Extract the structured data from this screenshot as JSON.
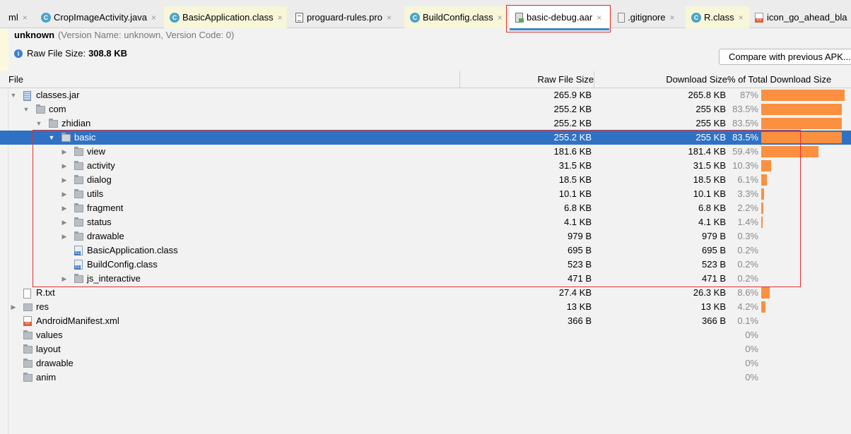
{
  "tabs": [
    {
      "label": "ml",
      "close": "×",
      "icon": "file-icon",
      "style": "plain"
    },
    {
      "label": "CropImageActivity.java",
      "close": "×",
      "icon": "class-icon",
      "icon_glyph": "C",
      "style": "plain"
    },
    {
      "label": "BasicApplication.class",
      "close": "×",
      "icon": "class-icon",
      "icon_glyph": "C",
      "style": "yellow"
    },
    {
      "label": "proguard-rules.pro",
      "close": "×",
      "icon": "file-icon",
      "style": "plain"
    },
    {
      "label": "BuildConfig.class",
      "close": "×",
      "icon": "class-icon",
      "icon_glyph": "C",
      "style": "yellow"
    },
    {
      "label": "basic-debug.aar",
      "close": "×",
      "icon": "aar-icon",
      "style": "active"
    },
    {
      "label": ".gitignore",
      "close": "×",
      "icon": "gitignore-icon",
      "style": "plain"
    },
    {
      "label": "R.class",
      "close": "×",
      "icon": "class-icon",
      "icon_glyph": "C",
      "style": "yellow"
    },
    {
      "label": "icon_go_ahead_bla",
      "close": "",
      "icon": "xml-icon",
      "style": "plain"
    }
  ],
  "summary": {
    "app_name": "unknown",
    "version_info": "(Version Name: unknown, Version Code: 0)",
    "info_glyph": "i",
    "raw_file_size_label": "Raw File Size:",
    "raw_file_size_value": "308.8 KB",
    "compare_button": "Compare with previous APK..."
  },
  "table": {
    "columns": [
      "File",
      "Raw File Size",
      "Download Size",
      "% of Total Download Size"
    ],
    "rows": [
      {
        "name": "classes.jar",
        "depth": 0,
        "arrow": "▼",
        "icon": "jar-icon",
        "raw": "265.9 KB",
        "download": "265.8 KB",
        "percent": "87%",
        "fraction": 0.87,
        "selected": false
      },
      {
        "name": "com",
        "depth": 1,
        "arrow": "▼",
        "icon": "folder-icon",
        "raw": "255.2 KB",
        "download": "255 KB",
        "percent": "83.5%",
        "fraction": 0.835,
        "selected": false
      },
      {
        "name": "zhidian",
        "depth": 2,
        "arrow": "▼",
        "icon": "folder-icon",
        "raw": "255.2 KB",
        "download": "255 KB",
        "percent": "83.5%",
        "fraction": 0.835,
        "selected": false
      },
      {
        "name": "basic",
        "depth": 3,
        "arrow": "▼",
        "icon": "folder-icon",
        "raw": "255.2 KB",
        "download": "255 KB",
        "percent": "83.5%",
        "fraction": 0.835,
        "selected": true
      },
      {
        "name": "view",
        "depth": 4,
        "arrow": "▶",
        "icon": "folder-icon",
        "raw": "181.6 KB",
        "download": "181.4 KB",
        "percent": "59.4%",
        "fraction": 0.594,
        "selected": false
      },
      {
        "name": "activity",
        "depth": 4,
        "arrow": "▶",
        "icon": "folder-icon",
        "raw": "31.5 KB",
        "download": "31.5 KB",
        "percent": "10.3%",
        "fraction": 0.103,
        "selected": false
      },
      {
        "name": "dialog",
        "depth": 4,
        "arrow": "▶",
        "icon": "folder-icon",
        "raw": "18.5 KB",
        "download": "18.5 KB",
        "percent": "6.1%",
        "fraction": 0.061,
        "selected": false
      },
      {
        "name": "utils",
        "depth": 4,
        "arrow": "▶",
        "icon": "folder-icon",
        "raw": "10.1 KB",
        "download": "10.1 KB",
        "percent": "3.3%",
        "fraction": 0.033,
        "selected": false
      },
      {
        "name": "fragment",
        "depth": 4,
        "arrow": "▶",
        "icon": "folder-icon",
        "raw": "6.8 KB",
        "download": "6.8 KB",
        "percent": "2.2%",
        "fraction": 0.022,
        "selected": false
      },
      {
        "name": "status",
        "depth": 4,
        "arrow": "▶",
        "icon": "folder-icon",
        "raw": "4.1 KB",
        "download": "4.1 KB",
        "percent": "1.4%",
        "fraction": 0.014,
        "selected": false
      },
      {
        "name": "drawable",
        "depth": 4,
        "arrow": "▶",
        "icon": "folder-icon",
        "raw": "979 B",
        "download": "979 B",
        "percent": "0.3%",
        "fraction": 0.003,
        "selected": false
      },
      {
        "name": "BasicApplication.class",
        "depth": 4,
        "arrow": "",
        "icon": "class-file-icon",
        "raw": "695 B",
        "download": "695 B",
        "percent": "0.2%",
        "fraction": 0.002,
        "selected": false
      },
      {
        "name": "BuildConfig.class",
        "depth": 4,
        "arrow": "",
        "icon": "class-file-icon",
        "raw": "523 B",
        "download": "523 B",
        "percent": "0.2%",
        "fraction": 0.002,
        "selected": false
      },
      {
        "name": "js_interactive",
        "depth": 4,
        "arrow": "▶",
        "icon": "folder-icon",
        "raw": "471 B",
        "download": "471 B",
        "percent": "0.2%",
        "fraction": 0.002,
        "selected": false
      },
      {
        "name": "R.txt",
        "depth": 0,
        "arrow": "",
        "icon": "txt-file-icon",
        "raw": "27.4 KB",
        "download": "26.3 KB",
        "percent": "8.6%",
        "fraction": 0.086,
        "selected": false
      },
      {
        "name": "res",
        "depth": 0,
        "arrow": "▶",
        "icon": "res-folder-icon",
        "raw": "13 KB",
        "download": "13 KB",
        "percent": "4.2%",
        "fraction": 0.042,
        "selected": false
      },
      {
        "name": "AndroidManifest.xml",
        "depth": 0,
        "arrow": "",
        "icon": "xml-icon",
        "raw": "366 B",
        "download": "366 B",
        "percent": "0.1%",
        "fraction": 0.001,
        "selected": false
      },
      {
        "name": "values",
        "depth": 0,
        "arrow": "",
        "icon": "folder-icon",
        "raw": "",
        "download": "",
        "percent": "0%",
        "fraction": 0,
        "selected": false
      },
      {
        "name": "layout",
        "depth": 0,
        "arrow": "",
        "icon": "folder-icon",
        "raw": "",
        "download": "",
        "percent": "0%",
        "fraction": 0,
        "selected": false
      },
      {
        "name": "drawable",
        "depth": 0,
        "arrow": "",
        "icon": "folder-icon",
        "raw": "",
        "download": "",
        "percent": "0%",
        "fraction": 0,
        "selected": false
      },
      {
        "name": "anim",
        "depth": 0,
        "arrow": "",
        "icon": "folder-icon",
        "raw": "",
        "download": "",
        "percent": "0%",
        "fraction": 0,
        "selected": false
      }
    ]
  },
  "colors": {
    "selection": "#2f72c4",
    "bar": "#fb9040",
    "highlight_box": "#e03030",
    "active_tab_underline": "#4083c9"
  }
}
